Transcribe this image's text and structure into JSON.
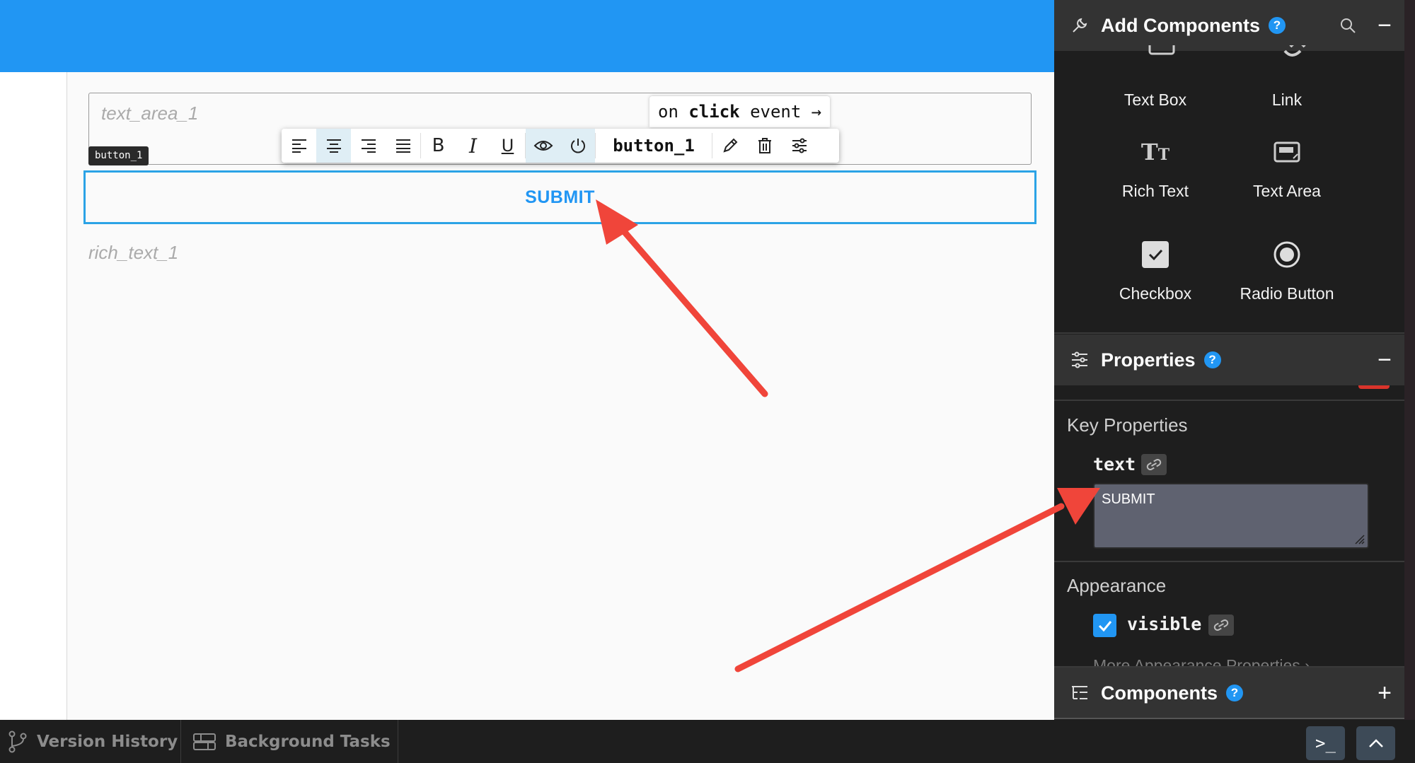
{
  "canvas": {
    "text_area_placeholder": "text_area_1",
    "button_tag": "button_1",
    "event_chip": {
      "prefix": "on",
      "keyword": "click",
      "suffix": "event",
      "arrow": "→"
    },
    "toolbar": {
      "component_name": "button_1",
      "align_left_icon": "align-left-icon",
      "align_center_icon": "align-center-icon",
      "align_right_icon": "align-right-icon",
      "align_justify_icon": "align-justify-icon",
      "bold_glyph": "B",
      "italic_glyph": "I",
      "underline_glyph": "U"
    },
    "submit_label": "SUBMIT",
    "rich_text_placeholder": "rich_text_1"
  },
  "panel": {
    "add_components": {
      "title": "Add Components",
      "help": "?",
      "collapse": "−",
      "items": [
        {
          "label": "Text Box",
          "icon": "text-box-icon"
        },
        {
          "label": "Link",
          "icon": "link-icon"
        },
        {
          "label": "Rich Text",
          "icon": "rich-text-icon"
        },
        {
          "label": "Text Area",
          "icon": "text-area-icon"
        },
        {
          "label": "Checkbox",
          "icon": "checkbox-icon"
        },
        {
          "label": "Radio Button",
          "icon": "radio-button-icon"
        }
      ]
    },
    "properties": {
      "title": "Properties",
      "help": "?",
      "collapse": "−",
      "key_properties_title": "Key Properties",
      "text_prop_label": "text",
      "text_value": "SUBMIT",
      "appearance_title": "Appearance",
      "visible_label": "visible",
      "visible_checked": true,
      "more_appearance": "More Appearance Properties ›"
    },
    "components": {
      "title": "Components",
      "help": "?",
      "add": "+"
    }
  },
  "bottom_bar": {
    "version_history": "Version History",
    "background_tasks": "Background Tasks",
    "terminal_glyph": ">_",
    "expand_glyph": "︿"
  },
  "colors": {
    "accent_blue": "#2196f3",
    "panel_bg": "#1e1e1e",
    "header_bg": "#333333",
    "annotation_red": "#f0453a"
  }
}
